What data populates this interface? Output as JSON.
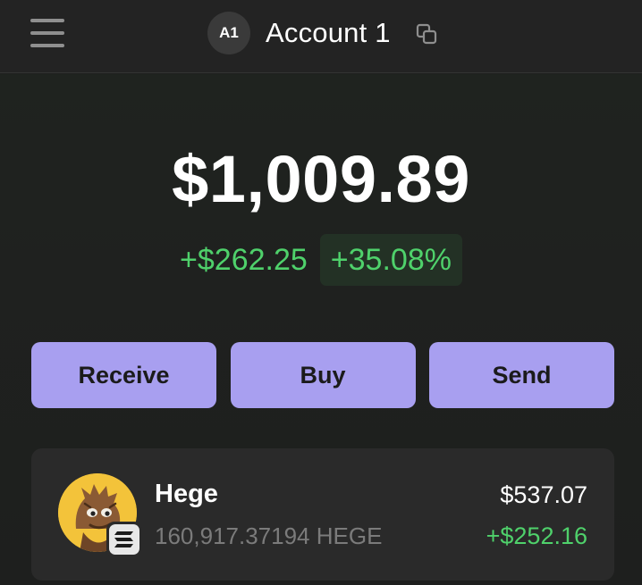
{
  "header": {
    "avatar_initials": "A1",
    "account_name": "Account 1"
  },
  "portfolio": {
    "balance": "$1,009.89",
    "change_amount": "+$262.25",
    "change_percent": "+35.08%"
  },
  "actions": {
    "receive_label": "Receive",
    "buy_label": "Buy",
    "send_label": "Send"
  },
  "tokens": [
    {
      "name": "Hege",
      "amount": "160,917.37194 HEGE",
      "value": "$537.07",
      "change": "+$252.16",
      "icon": "hege-token-logo",
      "chain_icon": "solana-icon"
    }
  ],
  "colors": {
    "accent_purple": "#a89ff0",
    "positive_green": "#4fd16b",
    "background": "#1e1f1e",
    "card": "#2a2a2a"
  }
}
